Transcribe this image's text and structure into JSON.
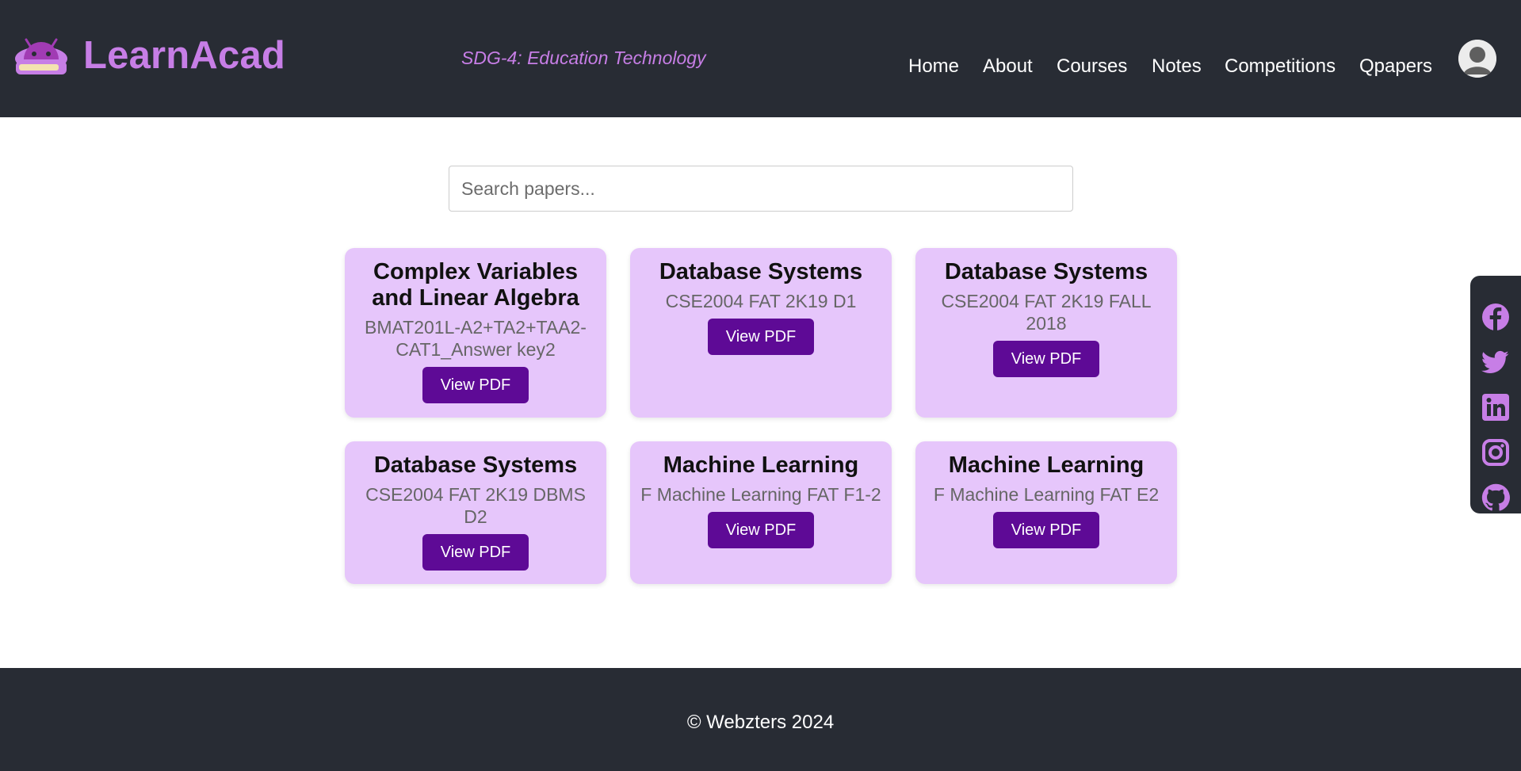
{
  "header": {
    "brand": "LearnAcad",
    "tagline": "SDG-4: Education Technology",
    "nav": [
      "Home",
      "About",
      "Courses",
      "Notes",
      "Competitions",
      "Qpapers"
    ]
  },
  "search": {
    "placeholder": "Search papers..."
  },
  "papers": [
    {
      "title": "Complex Variables and Linear Algebra",
      "code": "BMAT201L-A2+TA2+TAA2-CAT1_Answer key2",
      "button": "View PDF"
    },
    {
      "title": "Database Systems",
      "code": "CSE2004 FAT 2K19 D1",
      "button": "View PDF"
    },
    {
      "title": "Database Systems",
      "code": "CSE2004 FAT 2K19 FALL 2018",
      "button": "View PDF"
    },
    {
      "title": "Database Systems",
      "code": "CSE2004 FAT 2K19 DBMS D2",
      "button": "View PDF"
    },
    {
      "title": "Machine Learning",
      "code": "F Machine Learning FAT F1-2",
      "button": "View PDF"
    },
    {
      "title": "Machine Learning",
      "code": "F Machine Learning FAT E2",
      "button": "View PDF"
    }
  ],
  "social": [
    "facebook-icon",
    "twitter-icon",
    "linkedin-icon",
    "instagram-icon",
    "github-icon"
  ],
  "footer": {
    "copyright": "© Webzters 2024"
  },
  "colors": {
    "accent": "#c77ee6",
    "dark": "#282c34",
    "card": "#e6c6fb",
    "button": "#5e0a96"
  }
}
